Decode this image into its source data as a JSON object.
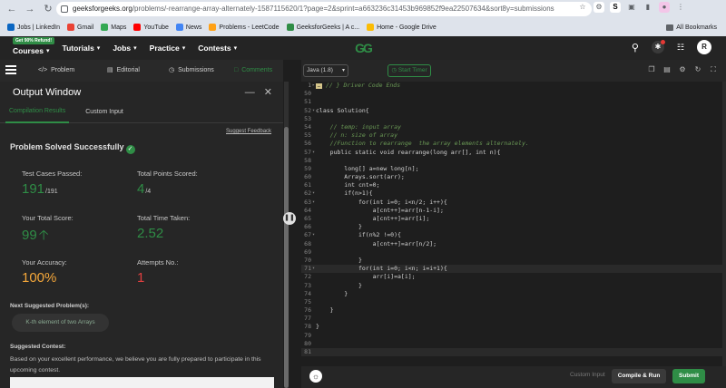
{
  "browser": {
    "url_domain": "geeksforgeeks.org",
    "url_rest": "/problems/-rearrange-array-alternately-1587115620/1?page=2&sprint=a663236c31453b969852f9ea22507634&sort8y=submissions",
    "bookmarks": [
      {
        "label": "Jobs | LinkedIn",
        "color": "#0a66c2"
      },
      {
        "label": "Gmail",
        "color": "#ea4335"
      },
      {
        "label": "Maps",
        "color": "#34a853"
      },
      {
        "label": "YouTube",
        "color": "#ff0000"
      },
      {
        "label": "News",
        "color": "#4285f4"
      },
      {
        "label": "Problems - LeetCode",
        "color": "#ffa116"
      },
      {
        "label": "GeeksforGeeks | A c...",
        "color": "#2f8d46"
      },
      {
        "label": "Home - Google Drive",
        "color": "#fbbc04"
      }
    ],
    "all_bookmarks": "All Bookmarks"
  },
  "gfg_nav": {
    "promo": "Get 90% Refund!",
    "items": [
      "Courses",
      "Tutorials",
      "Jobs",
      "Practice",
      "Contests"
    ],
    "logo": "GG",
    "avatar": "R"
  },
  "tabs": {
    "problem": "Problem",
    "editorial": "Editorial",
    "submissions": "Submissions",
    "comments": "Comments"
  },
  "output": {
    "title": "Output Window",
    "tab_compilation": "Compilation Results",
    "tab_custom": "Custom Input",
    "feedback": "Suggest Feedback",
    "status": "Problem Solved Successfully",
    "test_cases_label": "Test Cases Passed:",
    "test_cases_value": "191",
    "test_cases_total": "/191",
    "points_label": "Total Points Scored:",
    "points_value": "4",
    "points_total": "/4",
    "score_label": "Your Total Score:",
    "score_value": "99",
    "time_label": "Total Time Taken:",
    "time_value": "2.52",
    "accuracy_label": "Your Accuracy:",
    "accuracy_value": "100%",
    "attempts_label": "Attempts No.:",
    "attempts_value": "1",
    "next_label": "Next Suggested Problem(s):",
    "next_problem": "K-th element of two Arrays",
    "contest_label": "Suggested Contest:",
    "contest_text": "Based on your excellent performance, we believe you are fully prepared to participate in this upcoming contest."
  },
  "editor": {
    "language": "Java (1.8)",
    "timer": "Start Timer",
    "custom_input": "Custom Input",
    "compile_run": "Compile & Run",
    "submit": "Submit",
    "lines": [
      {
        "n": "1",
        "fold": "▸",
        "code": "// } Driver Code Ends",
        "cls": "cm",
        "collapsed": true
      },
      {
        "n": "50",
        "fold": "",
        "code": "",
        "cls": ""
      },
      {
        "n": "51",
        "fold": "",
        "code": "",
        "cls": ""
      },
      {
        "n": "52",
        "fold": "▾",
        "code": "class Solution{",
        "cls": ""
      },
      {
        "n": "53",
        "fold": "",
        "code": "",
        "cls": ""
      },
      {
        "n": "54",
        "fold": "",
        "code": "    // temp: input array",
        "cls": "cm"
      },
      {
        "n": "55",
        "fold": "",
        "code": "    // n: size of array",
        "cls": "cm"
      },
      {
        "n": "56",
        "fold": "",
        "code": "    //Function to rearrange  the array elements alternately.",
        "cls": "cm"
      },
      {
        "n": "57",
        "fold": "▾",
        "code": "    public static void rearrange(long arr[], int n){",
        "cls": ""
      },
      {
        "n": "58",
        "fold": "",
        "code": "",
        "cls": ""
      },
      {
        "n": "59",
        "fold": "",
        "code": "        long[] a=new long[n];",
        "cls": ""
      },
      {
        "n": "60",
        "fold": "",
        "code": "        Arrays.sort(arr);",
        "cls": ""
      },
      {
        "n": "61",
        "fold": "",
        "code": "        int cnt=0;",
        "cls": ""
      },
      {
        "n": "62",
        "fold": "▾",
        "code": "        if(n>1){",
        "cls": ""
      },
      {
        "n": "63",
        "fold": "▾",
        "code": "            for(int i=0; i<n/2; i++){",
        "cls": ""
      },
      {
        "n": "64",
        "fold": "",
        "code": "                a[cnt++]=arr[n-1-i];",
        "cls": ""
      },
      {
        "n": "65",
        "fold": "",
        "code": "                a[cnt++]=arr[i];",
        "cls": ""
      },
      {
        "n": "66",
        "fold": "",
        "code": "            }",
        "cls": ""
      },
      {
        "n": "67",
        "fold": "▾",
        "code": "            if(n%2 !=0){",
        "cls": ""
      },
      {
        "n": "68",
        "fold": "",
        "code": "                a[cnt++]=arr[n/2];",
        "cls": ""
      },
      {
        "n": "69",
        "fold": "",
        "code": "",
        "cls": ""
      },
      {
        "n": "70",
        "fold": "",
        "code": "            }",
        "cls": ""
      },
      {
        "n": "71",
        "fold": "▾",
        "code": "            for(int i=0; i<n; i=i+1){",
        "cls": "",
        "hl": true
      },
      {
        "n": "72",
        "fold": "",
        "code": "                arr[i]=a[i];",
        "cls": ""
      },
      {
        "n": "73",
        "fold": "",
        "code": "            }",
        "cls": ""
      },
      {
        "n": "74",
        "fold": "",
        "code": "        }",
        "cls": ""
      },
      {
        "n": "75",
        "fold": "",
        "code": "",
        "cls": ""
      },
      {
        "n": "76",
        "fold": "",
        "code": "    }",
        "cls": ""
      },
      {
        "n": "77",
        "fold": "",
        "code": "",
        "cls": ""
      },
      {
        "n": "78",
        "fold": "",
        "code": "}",
        "cls": ""
      },
      {
        "n": "79",
        "fold": "",
        "code": "",
        "cls": ""
      },
      {
        "n": "80",
        "fold": "",
        "code": "",
        "cls": ""
      },
      {
        "n": "81",
        "fold": "",
        "code": "",
        "cls": "",
        "hl": true
      }
    ]
  },
  "colors": {
    "accent": "#2f8d46",
    "orange": "#f4a73a",
    "red": "#e04040"
  }
}
